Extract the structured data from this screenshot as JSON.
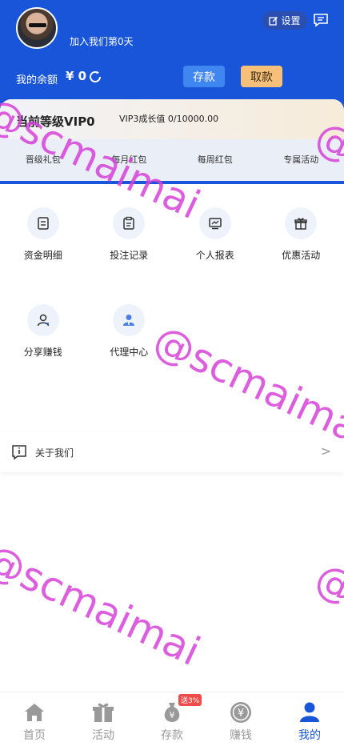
{
  "header": {
    "join_text": "加入我们第0天",
    "settings_label": "设置",
    "balance_label": "我的余额",
    "balance_value": "¥ 0",
    "deposit_label": "存款",
    "withdraw_label": "取款"
  },
  "vip": {
    "level": "当前等级VIP0",
    "growth": "VIP3成长值 0/10000.00",
    "tabs": [
      "晋级礼包",
      "每月红包",
      "每周红包",
      "专属活动"
    ]
  },
  "grid": {
    "row1": [
      {
        "label": "资金明细",
        "icon": "fund-detail-icon"
      },
      {
        "label": "投注记录",
        "icon": "bet-record-icon"
      },
      {
        "label": "个人报表",
        "icon": "report-icon"
      },
      {
        "label": "优惠活动",
        "icon": "gift-icon"
      }
    ],
    "row2": [
      {
        "label": "分享赚钱",
        "icon": "share-icon"
      },
      {
        "label": "代理中心",
        "icon": "agent-icon"
      }
    ]
  },
  "about": {
    "label": "关于我们",
    "arrow": ">"
  },
  "watermark": "@scmaimai",
  "tabbar": {
    "items": [
      {
        "label": "首页",
        "icon": "home-icon"
      },
      {
        "label": "活动",
        "icon": "gift-box-icon"
      },
      {
        "label": "存款",
        "icon": "money-bag-icon",
        "badge": "送3%"
      },
      {
        "label": "赚钱",
        "icon": "coin-icon"
      },
      {
        "label": "我的",
        "icon": "user-icon"
      }
    ],
    "active_index": 4
  },
  "colors": {
    "primary": "#1955d8",
    "deposit": "#3f86f0",
    "withdraw": "#f6c07b",
    "watermark": "#d742d9"
  }
}
